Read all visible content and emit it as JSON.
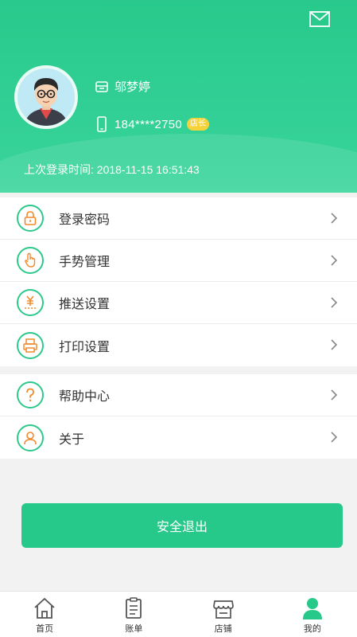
{
  "header": {
    "user_name": "邬梦婷",
    "phone": "184****2750",
    "role_badge": "店长",
    "last_login": "上次登录时间: 2018-11-15 16:51:43",
    "mail_icon": "mail-icon",
    "background_color": "#2ecd92"
  },
  "menu_group1": [
    {
      "label": "登录密码",
      "icon": "lock-icon"
    },
    {
      "label": "手势管理",
      "icon": "hand-gesture-icon"
    },
    {
      "label": "推送设置",
      "icon": "yen-push-icon"
    },
    {
      "label": "打印设置",
      "icon": "printer-icon"
    }
  ],
  "menu_group2": [
    {
      "label": "帮助中心",
      "icon": "help-icon"
    },
    {
      "label": "关于",
      "icon": "about-user-icon"
    }
  ],
  "logout_label": "安全退出",
  "tabs": [
    {
      "label": "首页",
      "icon": "home-icon"
    },
    {
      "label": "账单",
      "icon": "bill-icon"
    },
    {
      "label": "店铺",
      "icon": "store-icon"
    },
    {
      "label": "我的",
      "icon": "profile-icon",
      "active": true
    }
  ],
  "colors": {
    "accent": "#27c98a",
    "icon_orange": "#f08a2b",
    "badge": "#f6d23a"
  }
}
